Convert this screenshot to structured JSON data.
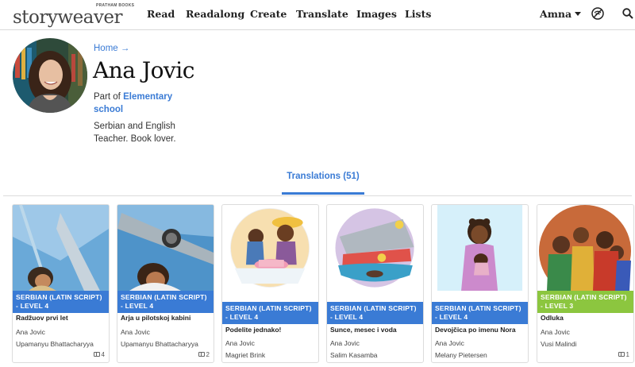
{
  "brand": {
    "publisher": "PRATHAM BOOKS",
    "logo_text": "storyweaver",
    "accent": "#e86a2c"
  },
  "nav": {
    "items": [
      "Read",
      "Readalong",
      "Create",
      "Translate",
      "Images",
      "Lists"
    ],
    "user": "Amna"
  },
  "profile": {
    "breadcrumb": "Home →",
    "name": "Ana Jovic",
    "part_of_prefix": "Part of",
    "organization": "Elementary school",
    "bio": "Serbian and English Teacher. Book lover."
  },
  "tabs": [
    {
      "label": "Translations (51)",
      "active": true
    }
  ],
  "colors": {
    "link": "#3a7bd5",
    "level4": "#3a7bd5",
    "level3": "#8cc63f"
  },
  "books": [
    {
      "level": "SERBIAN (LATIN SCRIPT) - LEVEL 4",
      "title": "Radžuov prvi let",
      "author": "Ana Jovic",
      "illustrator": "Upamanyu Bhattacharyya",
      "count": "4",
      "level_num": 4
    },
    {
      "level": "SERBIAN (LATIN SCRIPT) - LEVEL 4",
      "title": "Arja u pilotskoj kabini",
      "author": "Ana Jovic",
      "illustrator": "Upamanyu Bhattacharyya",
      "count": "2",
      "level_num": 4
    },
    {
      "level": "SERBIAN (LATIN SCRIPT) - LEVEL 4",
      "title": "Podelite jednako!",
      "author": "Ana Jovic",
      "illustrator": "Magriet Brink",
      "count": "",
      "level_num": 4
    },
    {
      "level": "SERBIAN (LATIN SCRIPT) - LEVEL 4",
      "title": "Sunce, mesec i voda",
      "author": "Ana Jovic",
      "illustrator": "Salim Kasamba",
      "count": "",
      "level_num": 4
    },
    {
      "level": "SERBIAN (LATIN SCRIPT) - LEVEL 4",
      "title": "Devojčica po imenu Nora",
      "author": "Ana Jovic",
      "illustrator": "Melany Pietersen",
      "count": "",
      "level_num": 4
    },
    {
      "level": "SERBIAN (LATIN SCRIPT) - LEVEL 3",
      "title": "Odluka",
      "author": "Ana Jovic",
      "illustrator": "Vusi Malindi",
      "count": "1",
      "level_num": 3
    }
  ]
}
